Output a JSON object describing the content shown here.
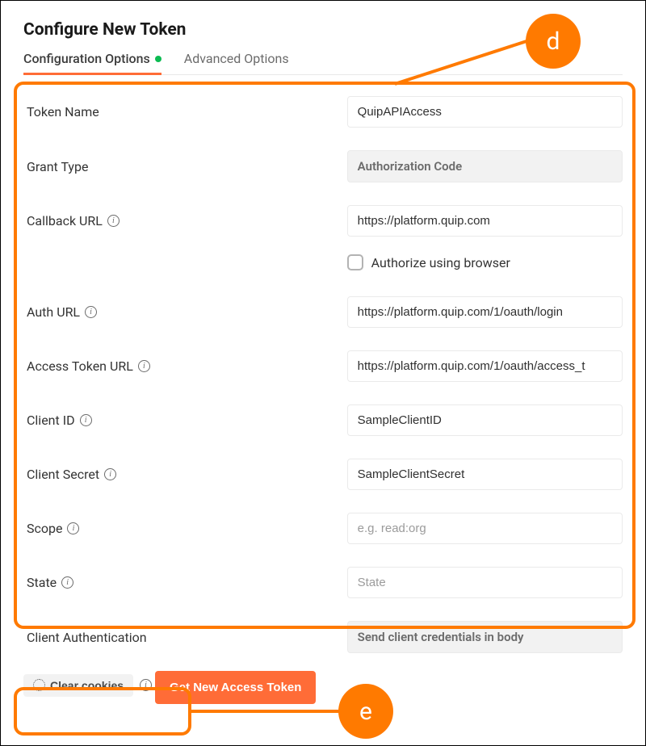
{
  "header": {
    "title": "Configure New Token"
  },
  "tabs": {
    "config": "Configuration Options",
    "advanced": "Advanced Options"
  },
  "fields": {
    "token_name": {
      "label": "Token Name",
      "value": "QuipAPIAccess"
    },
    "grant_type": {
      "label": "Grant Type",
      "value": "Authorization Code"
    },
    "callback_url": {
      "label": "Callback URL",
      "value": "https://platform.quip.com"
    },
    "authorize_browser": {
      "label": "Authorize using browser"
    },
    "auth_url": {
      "label": "Auth URL",
      "value": "https://platform.quip.com/1/oauth/login"
    },
    "access_token_url": {
      "label": "Access Token URL",
      "value": "https://platform.quip.com/1/oauth/access_t"
    },
    "client_id": {
      "label": "Client ID",
      "value": "SampleClientID"
    },
    "client_secret": {
      "label": "Client Secret",
      "value": "SampleClientSecret"
    },
    "scope": {
      "label": "Scope",
      "placeholder": "e.g. read:org"
    },
    "state": {
      "label": "State",
      "placeholder": "State"
    },
    "client_auth": {
      "label": "Client Authentication",
      "value": "Send client credentials in body"
    }
  },
  "footer": {
    "clear_cookies": "Clear cookies",
    "get_token": "Get New Access Token"
  },
  "annotations": {
    "d": "d",
    "e": "e"
  }
}
